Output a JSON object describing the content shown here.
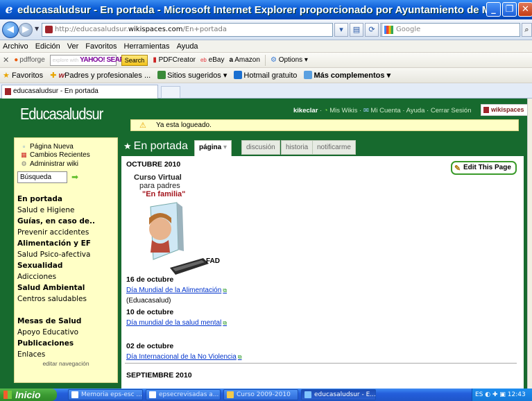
{
  "window": {
    "title": "educasaludsur - En portada - Microsoft Internet Explorer proporcionado por Ayuntamiento de Mósto...",
    "url_prefix": "http://educasaludsur.",
    "url_domain": "wikispaces.com",
    "url_path": "/En+portada",
    "search_placeholder": "Google"
  },
  "menu": [
    "Archivo",
    "Edición",
    "Ver",
    "Favoritos",
    "Herramientas",
    "Ayuda"
  ],
  "toolbar": {
    "pdfforge": "pdfforge",
    "yahoo_hint": "explore with",
    "yahoo_search": "YAHOO! SEARCH",
    "search_btn": "Search",
    "pdfcreator": "PDFCreator",
    "ebay": "eBay",
    "amazon": "Amazon",
    "options": "Options"
  },
  "favorites": {
    "favoritos": "Favoritos",
    "padres": "Padres y profesionales ...",
    "sitios": "Sitios sugeridos",
    "hotmail": "Hotmail gratuito",
    "complementos": "Más complementos"
  },
  "tab": {
    "label": "educasaludsur - En portada"
  },
  "wiki": {
    "logo": "Educasaludsur",
    "user": "kikeclar",
    "mis_wikis": "Mis Wikis",
    "mi_cuenta": "Mi Cuenta",
    "ayuda": "Ayuda",
    "cerrar_sesion": "Cerrar Sesión",
    "wikispaces": "wikispaces",
    "notice": "Ya esta logueado."
  },
  "sidebar": {
    "pagina_nueva": "Página Nueva",
    "cambios_recientes": "Cambios Recientes",
    "administrar": "Administrar wiki",
    "busqueda": "Búsqueda",
    "nav": [
      {
        "label": "En portada",
        "bold": true
      },
      {
        "label": "Salud e Higiene",
        "bold": false
      },
      {
        "label": "Guías, en caso de..",
        "bold": true
      },
      {
        "label": "Prevenir accidentes",
        "bold": false
      },
      {
        "label": "Alimentación y EF",
        "bold": true
      },
      {
        "label": "Salud Psico-afectiva",
        "bold": false
      },
      {
        "label": "Sexualidad",
        "bold": true
      },
      {
        "label": "Adicciones",
        "bold": false
      },
      {
        "label": "Salud Ambiental",
        "bold": true
      },
      {
        "label": "Centros saludables",
        "bold": false
      },
      {
        "label": "Mesas de Salud",
        "bold": true
      },
      {
        "label": "Apoyo Educativo",
        "bold": false
      },
      {
        "label": "Publicaciones",
        "bold": true
      },
      {
        "label": "Enlaces",
        "bold": false
      }
    ],
    "editar_nav": "editar navegación"
  },
  "page": {
    "title": "En portada",
    "tabs": [
      "página",
      "discusión",
      "historia",
      "notificarme"
    ],
    "edit_button": "Edit This Page"
  },
  "content": {
    "month1": "OCTUBRE 2010",
    "flyer_l1": "Curso Virtual",
    "flyer_l2": "para padres",
    "flyer_l3": "\"En familia\"",
    "fad": "FAD",
    "date1": "16 de octubre",
    "link1": "Día Mundial de la Alimentación",
    "source1": "(Eduacasalud)",
    "date2": "10 de octubre",
    "link2": "Día mundial de la salud mental",
    "date3": "02 de octubre",
    "link3": "Día Internacional de la No Violencia",
    "month2": "SEPTIEMBRE 2010"
  },
  "taskbar": {
    "start": "Inicio",
    "items": [
      "Memoria eps-esc ...",
      "epsecrevisadas a...",
      "Curso 2009-2010",
      "educasaludsur - E..."
    ],
    "lang": "ES",
    "time": "12:43"
  }
}
